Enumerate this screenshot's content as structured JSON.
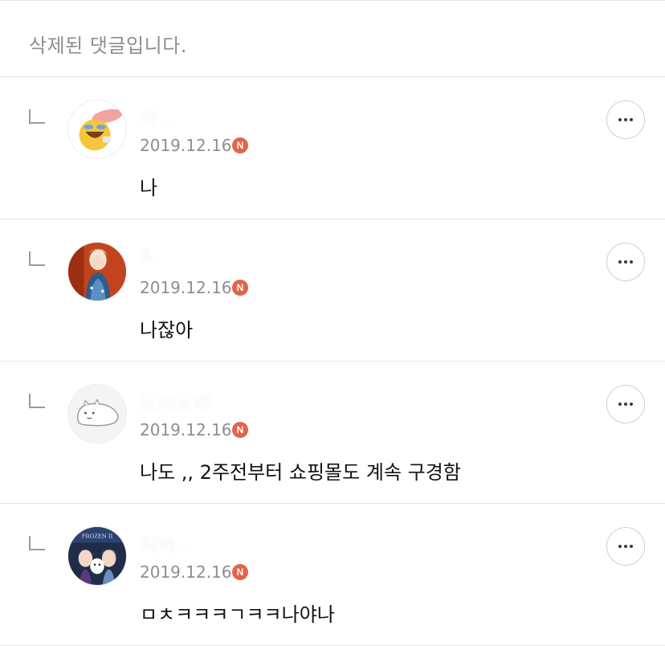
{
  "deleted_notice": "삭제된 댓글입니다.",
  "replies": [
    {
      "username": "아...",
      "date": "2019.12.16",
      "badge": "N",
      "text": "나",
      "avatar": "emoji-laughing-avatar",
      "more_icon": "more-horizontal-icon"
    },
    {
      "username": "A",
      "date": "2019.12.16",
      "badge": "N",
      "text": "나잖아",
      "avatar": "elsa-avatar",
      "more_icon": "more-horizontal-icon"
    },
    {
      "username": "도비도비",
      "date": "2019.12.16",
      "badge": "N",
      "text": "나도 ,, 2주전부터 쇼핑몰도 계속 구경함",
      "avatar": "white-creature-avatar",
      "more_icon": "more-horizontal-icon"
    },
    {
      "username": "지켜...",
      "date": "2019.12.16",
      "badge": "N",
      "text": "ㅁㅊㅋㅋㅋㄱㅋㅋ나야나",
      "avatar": "frozen-avatar",
      "more_icon": "more-horizontal-icon"
    }
  ],
  "colors": {
    "badge": "#e2654a",
    "date": "#8e8e8e",
    "divider": "#e6e6e6"
  }
}
